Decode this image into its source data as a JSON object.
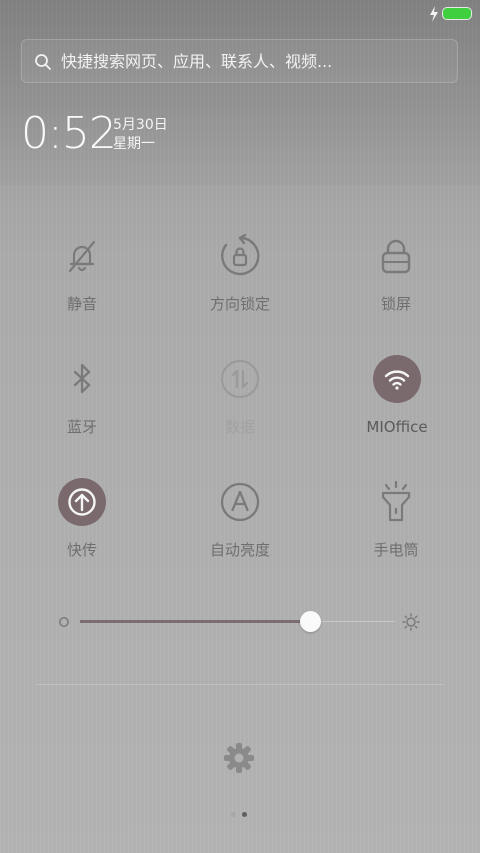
{
  "status_bar": {
    "battery_icon": "battery-full-icon",
    "charging_icon": "charging-bolt-icon",
    "battery_color": "#3fcf3f"
  },
  "search": {
    "placeholder": "快捷搜索网页、应用、联系人、视频..."
  },
  "clock": {
    "time": "0:52",
    "date": "5月30日",
    "weekday": "星期一"
  },
  "toggles": [
    {
      "label": "静音",
      "icon": "bell-off-icon",
      "active": false
    },
    {
      "label": "方向锁定",
      "icon": "rotation-lock-icon",
      "active": false
    },
    {
      "label": "锁屏",
      "icon": "lock-icon",
      "active": false
    },
    {
      "label": "蓝牙",
      "icon": "bluetooth-icon",
      "active": false
    },
    {
      "label": "数据",
      "icon": "mobile-data-icon",
      "active": false,
      "disabled": true
    },
    {
      "label": "MIOffice",
      "icon": "wifi-icon",
      "active": true
    },
    {
      "label": "快传",
      "icon": "quick-transfer-icon",
      "active": true
    },
    {
      "label": "自动亮度",
      "icon": "auto-brightness-icon",
      "active": false
    },
    {
      "label": "手电筒",
      "icon": "flashlight-icon",
      "active": false
    }
  ],
  "brightness": {
    "level": 0.74,
    "min_icon": "brightness-low-icon",
    "max_icon": "brightness-high-icon"
  },
  "settings": {
    "icon": "gear-icon"
  },
  "pager": {
    "pages": 2,
    "current": 2
  },
  "colors": {
    "active_circle": "#7a6a6e",
    "icon_gray": "#6f6f6f"
  }
}
